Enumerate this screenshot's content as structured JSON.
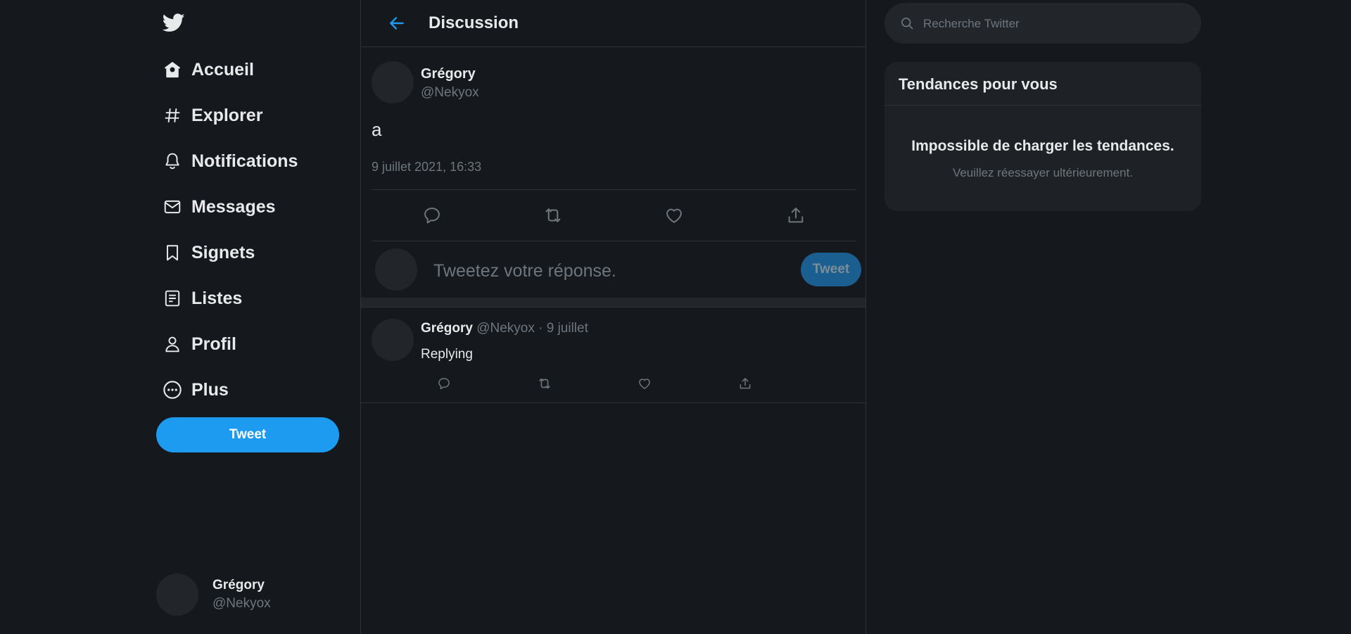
{
  "sidebar": {
    "logo": "twitter-bird-icon",
    "items": [
      {
        "label": "Accueil",
        "icon": "home-icon"
      },
      {
        "label": "Explorer",
        "icon": "hashtag-icon"
      },
      {
        "label": "Notifications",
        "icon": "bell-icon"
      },
      {
        "label": "Messages",
        "icon": "envelope-icon"
      },
      {
        "label": "Signets",
        "icon": "bookmark-icon"
      },
      {
        "label": "Listes",
        "icon": "list-icon"
      },
      {
        "label": "Profil",
        "icon": "person-icon"
      },
      {
        "label": "Plus",
        "icon": "more-circle-icon"
      }
    ],
    "tweet_button": "Tweet",
    "account": {
      "name": "Grégory",
      "handle": "@Nekyox"
    }
  },
  "main": {
    "title": "Discussion",
    "tweet": {
      "author": "Grégory",
      "handle": "@Nekyox",
      "text": "a",
      "date": "9 juillet 2021, 16:33"
    },
    "reply_box": {
      "placeholder": "Tweetez votre réponse.",
      "button": "Tweet"
    },
    "replies": [
      {
        "author": "Grégory",
        "meta": "@Nekyox · 9 juillet",
        "text": "Replying"
      }
    ]
  },
  "right": {
    "search_placeholder": "Recherche Twitter",
    "trends": {
      "title": "Tendances pour vous",
      "error": "Impossible de charger les tendances.",
      "sub": "Veuillez réessayer ultérieurement."
    }
  },
  "colors": {
    "background": "#15181c",
    "accent": "#1d9bf0",
    "muted_text": "#6e767d",
    "border": "#2f3336"
  }
}
